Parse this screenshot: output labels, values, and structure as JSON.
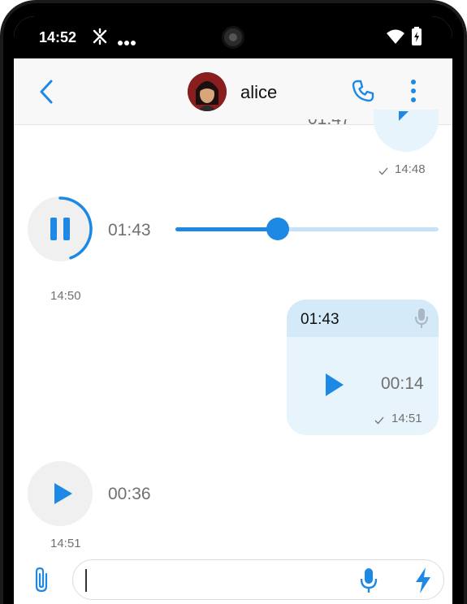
{
  "status_bar": {
    "time": "14:52"
  },
  "header": {
    "contact_name": "alice"
  },
  "messages": [
    {
      "id": "partial-sent",
      "timestamp": "14:48",
      "status": "read"
    },
    {
      "id": "received-playing",
      "duration": "01:43",
      "timestamp": "14:50",
      "state": "playing",
      "progress": 0.39
    },
    {
      "id": "sent-voice",
      "quoted_duration": "01:43",
      "duration": "00:14",
      "timestamp": "14:51",
      "status": "read"
    },
    {
      "id": "received-voice",
      "duration": "00:36",
      "timestamp": "14:51",
      "state": "paused"
    }
  ],
  "composer": {
    "placeholder": ""
  },
  "colors": {
    "accent": "#1e88e5",
    "bubble_sent": "#e8f4fc",
    "bubble_quote": "#d4eaf9",
    "muted_text": "#707070"
  }
}
